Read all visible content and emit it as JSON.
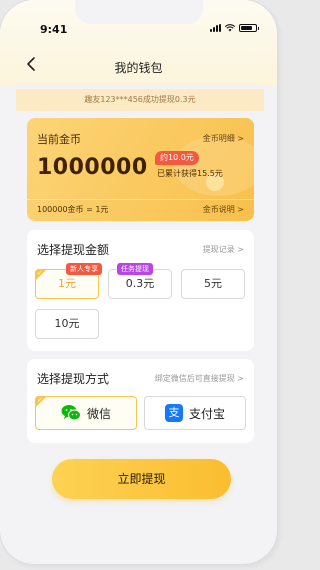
{
  "status_bar": {
    "time": "9:41"
  },
  "header": {
    "title": "我的钱包",
    "back_icon": "chevron-left-icon"
  },
  "notice": {
    "text": "趣友123***456成功提现0.3元"
  },
  "coin_card": {
    "title": "当前金币",
    "detail_link": "金币明细 >",
    "amount": "1000000",
    "badge": "约10.0元",
    "earned": "已累计获得15.5元",
    "rate": "100000金币 = 1元",
    "explain_link": "金币说明 >"
  },
  "amount_section": {
    "title": "选择提现金额",
    "link": "提现记录 >",
    "options": [
      {
        "label": "1元",
        "tag": "新人专享",
        "selected": true
      },
      {
        "label": "0.3元",
        "tag": "任务提现",
        "selected": false
      },
      {
        "label": "5元",
        "tag": "",
        "selected": false
      },
      {
        "label": "10元",
        "tag": "",
        "selected": false
      }
    ]
  },
  "method_section": {
    "title": "选择提现方式",
    "link": "绑定微信后可直接提现 >",
    "methods": [
      {
        "label": "微信",
        "icon": "wechat-icon",
        "selected": true
      },
      {
        "label": "支付宝",
        "icon": "alipay-icon",
        "icon_glyph": "支",
        "selected": false
      }
    ]
  },
  "submit": {
    "label": "立即提现"
  },
  "colors": {
    "accent": "#f9c54a",
    "tag_red": "#f5583f",
    "tag_purple": "#b944e8",
    "wechat_green": "#09bb07",
    "alipay_blue": "#1677ff"
  }
}
